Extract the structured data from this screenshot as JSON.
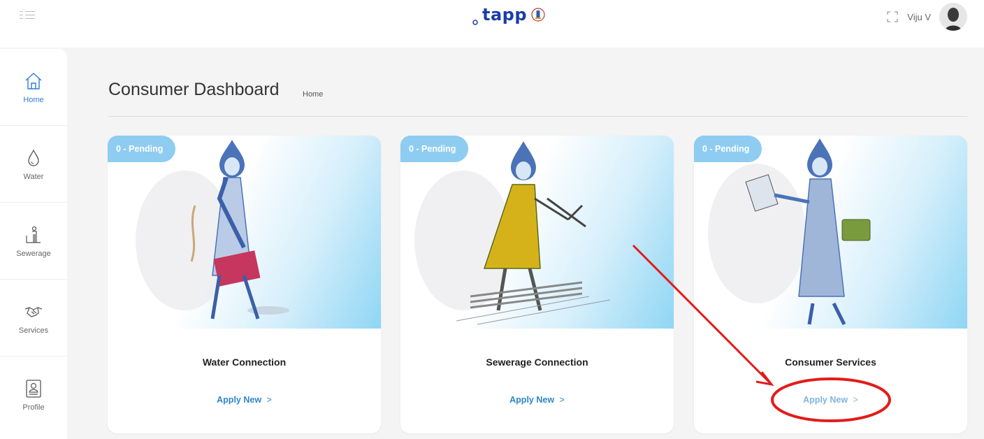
{
  "app": {
    "logo_text": "tapp",
    "user_name": "Viju V"
  },
  "sidebar": {
    "items": [
      {
        "label": "Home",
        "icon": "home-icon",
        "active": true
      },
      {
        "label": "Water",
        "icon": "water-drop-icon"
      },
      {
        "label": "Sewerage",
        "icon": "sewerage-icon"
      },
      {
        "label": "Services",
        "icon": "handshake-icon"
      },
      {
        "label": "Profile",
        "icon": "profile-icon"
      }
    ]
  },
  "page": {
    "title": "Consumer Dashboard",
    "breadcrumb": "Home"
  },
  "cards": [
    {
      "badge": "0 - Pending",
      "title": "Water Connection",
      "action": "Apply New",
      "chevron": ">"
    },
    {
      "badge": "0 - Pending",
      "title": "Sewerage Connection",
      "action": "Apply New",
      "chevron": ">"
    },
    {
      "badge": "0 - Pending",
      "title": "Consumer Services",
      "action": "Apply New",
      "chevron": ">"
    }
  ],
  "colors": {
    "accent": "#2d7bd6",
    "badge": "#8fccf1",
    "annotation": "#e31b1b"
  }
}
